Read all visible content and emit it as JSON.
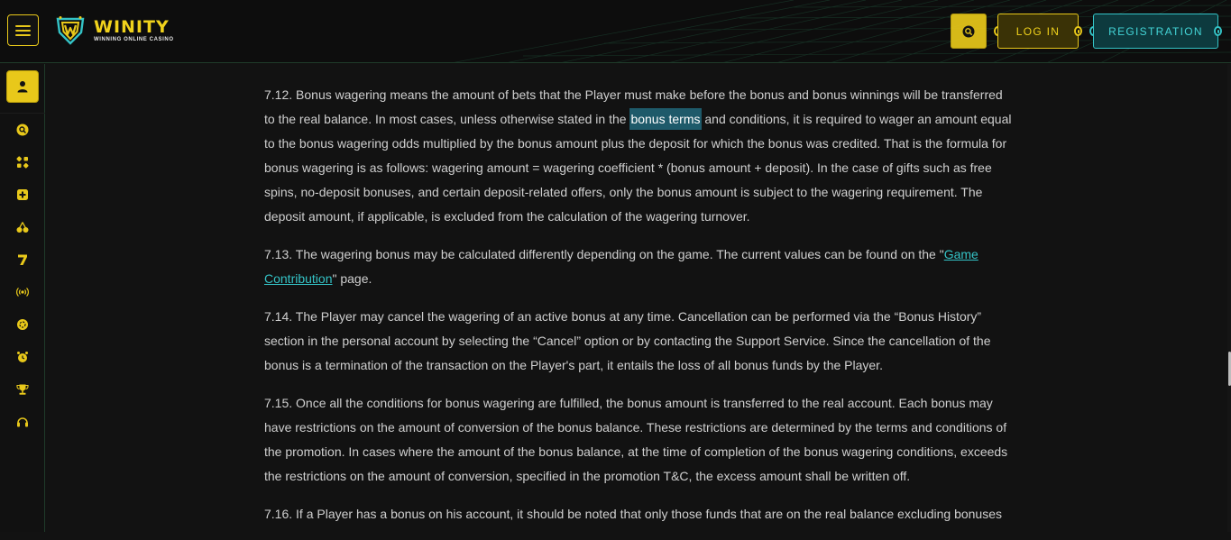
{
  "header": {
    "brand_name": "WINITY",
    "brand_tagline": "WINNING ONLINE CASINO",
    "login_label": "LOG IN",
    "registration_label": "REGISTRATION"
  },
  "colors": {
    "accent_yellow": "#e8c81a",
    "accent_cyan": "#34c3c6",
    "background": "#121212",
    "highlight": "#1e5a6a"
  },
  "sidebar": {
    "items": [
      {
        "icon": "user-icon"
      },
      {
        "icon": "search-icon"
      },
      {
        "icon": "games-grid-icon"
      },
      {
        "icon": "plus-card-icon"
      },
      {
        "icon": "cherries-icon"
      },
      {
        "icon": "seven-icon"
      },
      {
        "icon": "live-broadcast-icon"
      },
      {
        "icon": "chip-icon"
      },
      {
        "icon": "alarm-clock-icon"
      },
      {
        "icon": "trophy-icon"
      },
      {
        "icon": "headset-icon"
      }
    ]
  },
  "content": {
    "p712_a": "7.12. Bonus wagering means the amount of bets that the Player must make before the bonus and bonus winnings will be transferred to the real balance. In most cases, unless otherwise stated in the ",
    "p712_highlight": "bonus terms",
    "p712_b": " and conditions, it is required to wager an amount equal to the bonus wagering odds multiplied by the bonus amount plus the deposit for which the bonus was credited. That is the formula for bonus wagering is as follows: wagering amount = wagering coefficient * (bonus amount + deposit). In the case of gifts such as free spins, no-deposit bonuses, and certain deposit-related offers, only the bonus amount is subject to the wagering requirement. The deposit amount, if applicable, is excluded from the calculation of the wagering turnover.",
    "p713_a": "7.13. The wagering bonus may be calculated differently depending on the game. The current values can be found on the \"",
    "p713_link": "Game Contribution",
    "p713_b": "\" page.",
    "p714": "7.14. The Player may cancel the wagering of an active bonus at any time. Cancellation can be performed via the “Bonus History” section in the personal account by selecting the “Cancel” option or by contacting the Support Service. Since the cancellation of the bonus is a termination of the transaction on the Player's part, it entails the loss of all bonus funds by the Player.",
    "p715": "7.15. Once all the conditions for bonus wagering are fulfilled, the bonus amount is transferred to the real account. Each bonus may have restrictions on the amount of conversion of the bonus balance. These restrictions are determined by the terms and conditions of the promotion. In cases where the amount of the bonus balance, at the time of completion of the bonus wagering conditions, exceeds the restrictions on the amount of conversion, specified in the promotion T&C, the excess amount shall be written off.",
    "p716": "7.16. If a Player has a bonus on his account, it should be noted that only those funds that are on the real balance excluding bonuses"
  }
}
